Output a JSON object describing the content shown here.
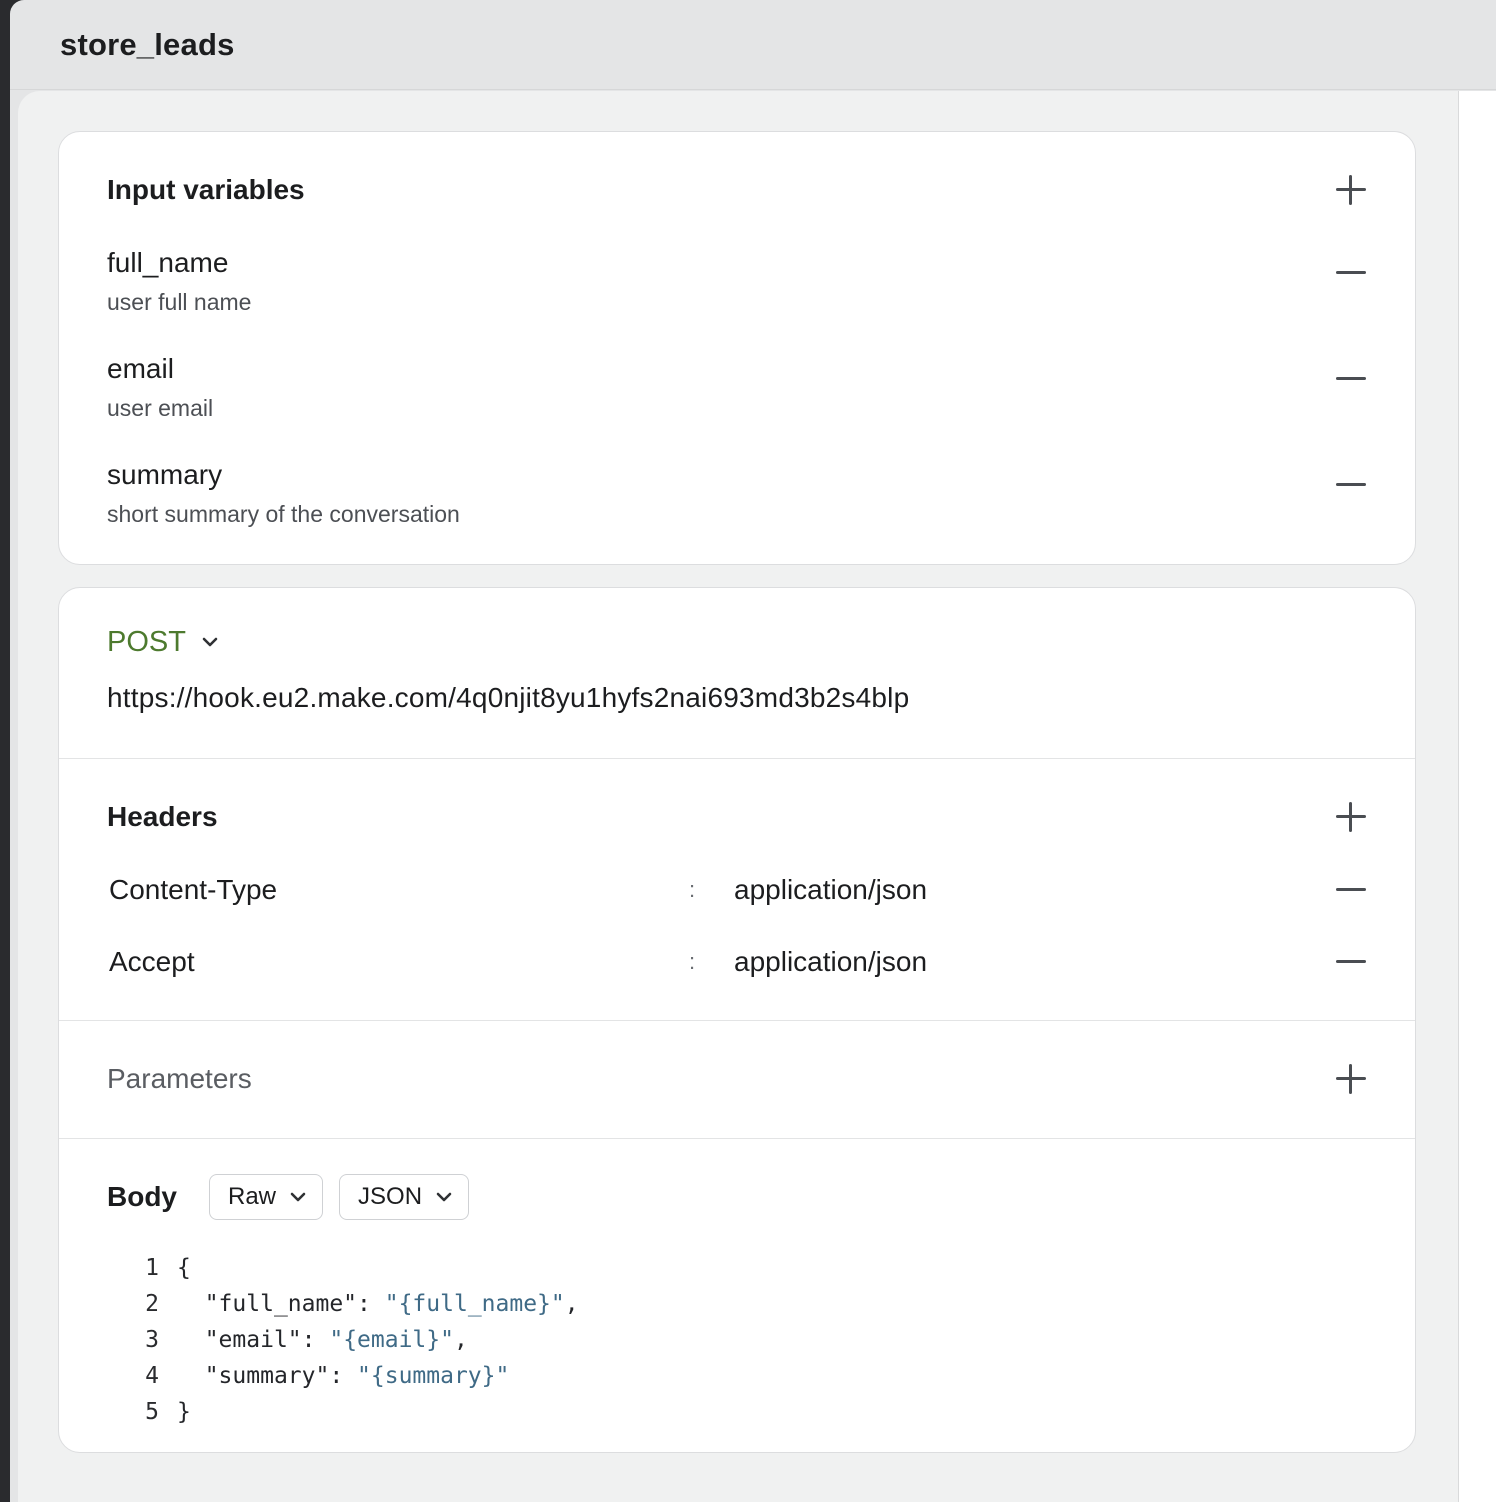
{
  "window": {
    "title": "store_leads"
  },
  "input_variables": {
    "title": "Input variables",
    "items": [
      {
        "name": "full_name",
        "description": "user full name"
      },
      {
        "name": "email",
        "description": "user email"
      },
      {
        "name": "summary",
        "description": "short summary of the conversation"
      }
    ]
  },
  "request": {
    "method": "POST",
    "url": "https://hook.eu2.make.com/4q0njit8yu1hyfs2nai693md3b2s4blp"
  },
  "headers": {
    "title": "Headers",
    "items": [
      {
        "key": "Content-Type",
        "separator": ":",
        "value": "application/json"
      },
      {
        "key": "Accept",
        "separator": ":",
        "value": "application/json"
      }
    ]
  },
  "parameters": {
    "title": "Parameters"
  },
  "body": {
    "title": "Body",
    "mode": "Raw",
    "format": "JSON",
    "lines": [
      {
        "num": "1",
        "indent": "",
        "key": "",
        "sep": "",
        "value": "",
        "text": "{"
      },
      {
        "num": "2",
        "indent": "  ",
        "key": "\"full_name\"",
        "sep": ": ",
        "value": "\"{full_name}\"",
        "text": ","
      },
      {
        "num": "3",
        "indent": "  ",
        "key": "\"email\"",
        "sep": ": ",
        "value": "\"{email}\"",
        "text": ","
      },
      {
        "num": "4",
        "indent": "  ",
        "key": "\"summary\"",
        "sep": ": ",
        "value": "\"{summary}\"",
        "text": ""
      },
      {
        "num": "5",
        "indent": "",
        "key": "",
        "sep": "",
        "value": "",
        "text": "}"
      }
    ]
  },
  "icons": {
    "add": "plus-icon",
    "remove": "minus-icon",
    "dropdown": "chevron-down-icon"
  },
  "colors": {
    "method": "#4d7a2e",
    "code_string": "#3f6a86",
    "panel_bg": "#f0f1f1",
    "titlebar_bg": "#e4e5e6"
  }
}
